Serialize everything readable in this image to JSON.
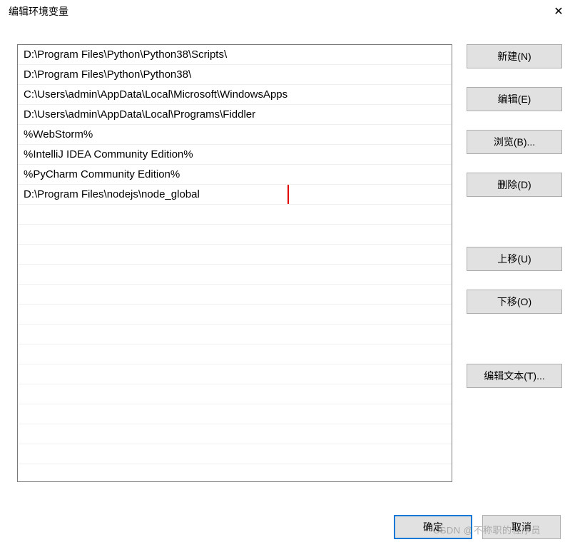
{
  "window": {
    "title": "编辑环境变量"
  },
  "list": {
    "items": [
      "D:\\Program Files\\Python\\Python38\\Scripts\\",
      "D:\\Program Files\\Python\\Python38\\",
      "C:\\Users\\admin\\AppData\\Local\\Microsoft\\WindowsApps",
      "D:\\Users\\admin\\AppData\\Local\\Programs\\Fiddler",
      "%WebStorm%",
      "%IntelliJ IDEA Community Edition%",
      "%PyCharm Community Edition%",
      "D:\\Program Files\\nodejs\\node_global"
    ],
    "highlighted_index": 7
  },
  "buttons": {
    "new": "新建(N)",
    "edit": "编辑(E)",
    "browse": "浏览(B)...",
    "delete": "删除(D)",
    "move_up": "上移(U)",
    "move_down": "下移(O)",
    "edit_text": "编辑文本(T)..."
  },
  "footer": {
    "ok": "确定",
    "cancel": "取消"
  },
  "watermark": "CSDN @不称职的程序员"
}
